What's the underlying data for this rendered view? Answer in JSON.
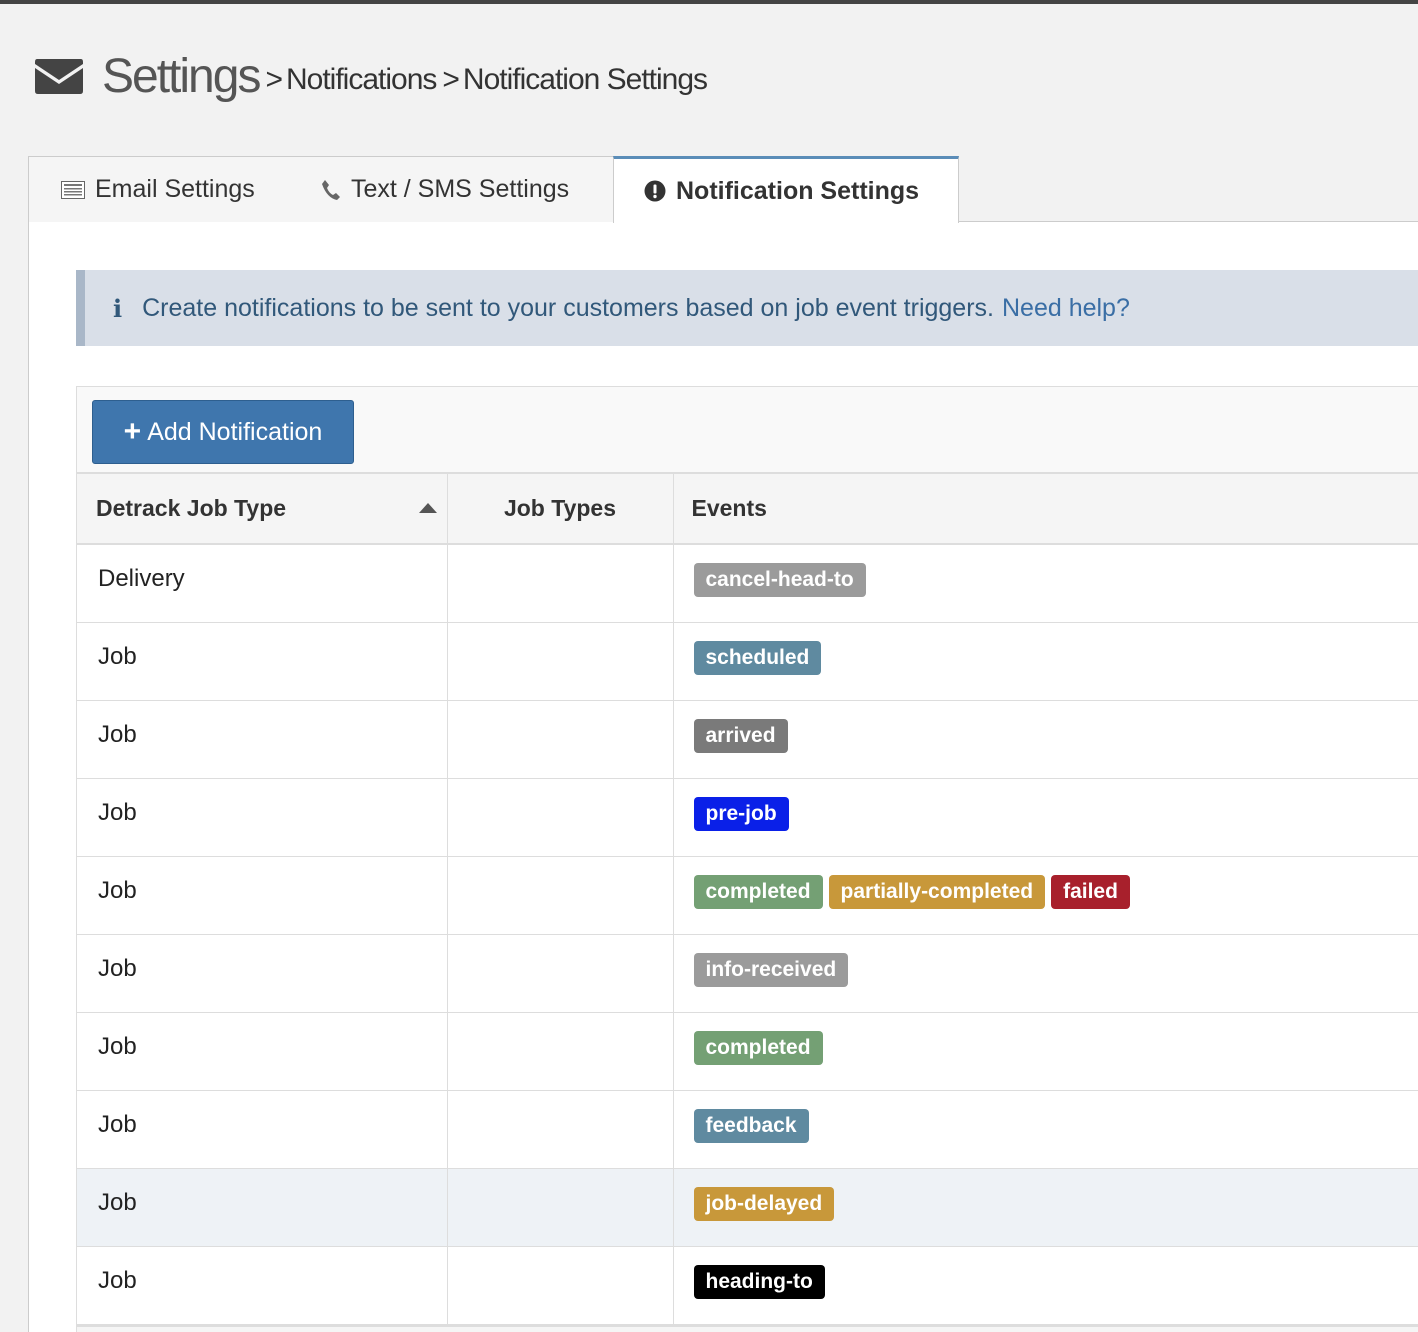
{
  "breadcrumb": {
    "main": "Settings",
    "sep1": ">",
    "item1": "Notifications",
    "sep2": ">",
    "item2": "Notification Settings"
  },
  "tabs": [
    {
      "label": "Email Settings",
      "icon": "list-icon"
    },
    {
      "label": "Text / SMS Settings",
      "icon": "phone-icon"
    },
    {
      "label": "Notification Settings",
      "icon": "exclamation-circle-icon",
      "active": true
    }
  ],
  "alert": {
    "text": "Create notifications to be sent to your customers based on job event triggers.",
    "link": "Need help?"
  },
  "toolbar": {
    "add_label": "Add Notification"
  },
  "table": {
    "headers": [
      "Detrack Job Type",
      "Job Types",
      "Events"
    ],
    "sorted_column": "Detrack Job Type",
    "sort_direction": "ascending",
    "rows": [
      {
        "type": "Delivery",
        "job_types": "",
        "events": [
          {
            "label": "cancel-head-to",
            "color": "#9b9b9b"
          }
        ]
      },
      {
        "type": "Job",
        "job_types": "",
        "events": [
          {
            "label": "scheduled",
            "color": "#5f8aa0"
          }
        ]
      },
      {
        "type": "Job",
        "job_types": "",
        "events": [
          {
            "label": "arrived",
            "color": "#7a7a7a"
          }
        ]
      },
      {
        "type": "Job",
        "job_types": "",
        "events": [
          {
            "label": "pre-job",
            "color": "#0a20e8"
          }
        ]
      },
      {
        "type": "Job",
        "job_types": "",
        "events": [
          {
            "label": "completed",
            "color": "#74a074"
          },
          {
            "label": "partially-completed",
            "color": "#c8983a"
          },
          {
            "label": "failed",
            "color": "#a8202c"
          }
        ]
      },
      {
        "type": "Job",
        "job_types": "",
        "events": [
          {
            "label": "info-received",
            "color": "#9b9b9b"
          }
        ]
      },
      {
        "type": "Job",
        "job_types": "",
        "events": [
          {
            "label": "completed",
            "color": "#74a074"
          }
        ]
      },
      {
        "type": "Job",
        "job_types": "",
        "events": [
          {
            "label": "feedback",
            "color": "#5f8aa0"
          }
        ]
      },
      {
        "type": "Job",
        "job_types": "",
        "events": [
          {
            "label": "job-delayed",
            "color": "#c8983a"
          }
        ],
        "highlighted": true
      },
      {
        "type": "Job",
        "job_types": "",
        "events": [
          {
            "label": "heading-to",
            "color": "#000000"
          }
        ]
      }
    ]
  }
}
